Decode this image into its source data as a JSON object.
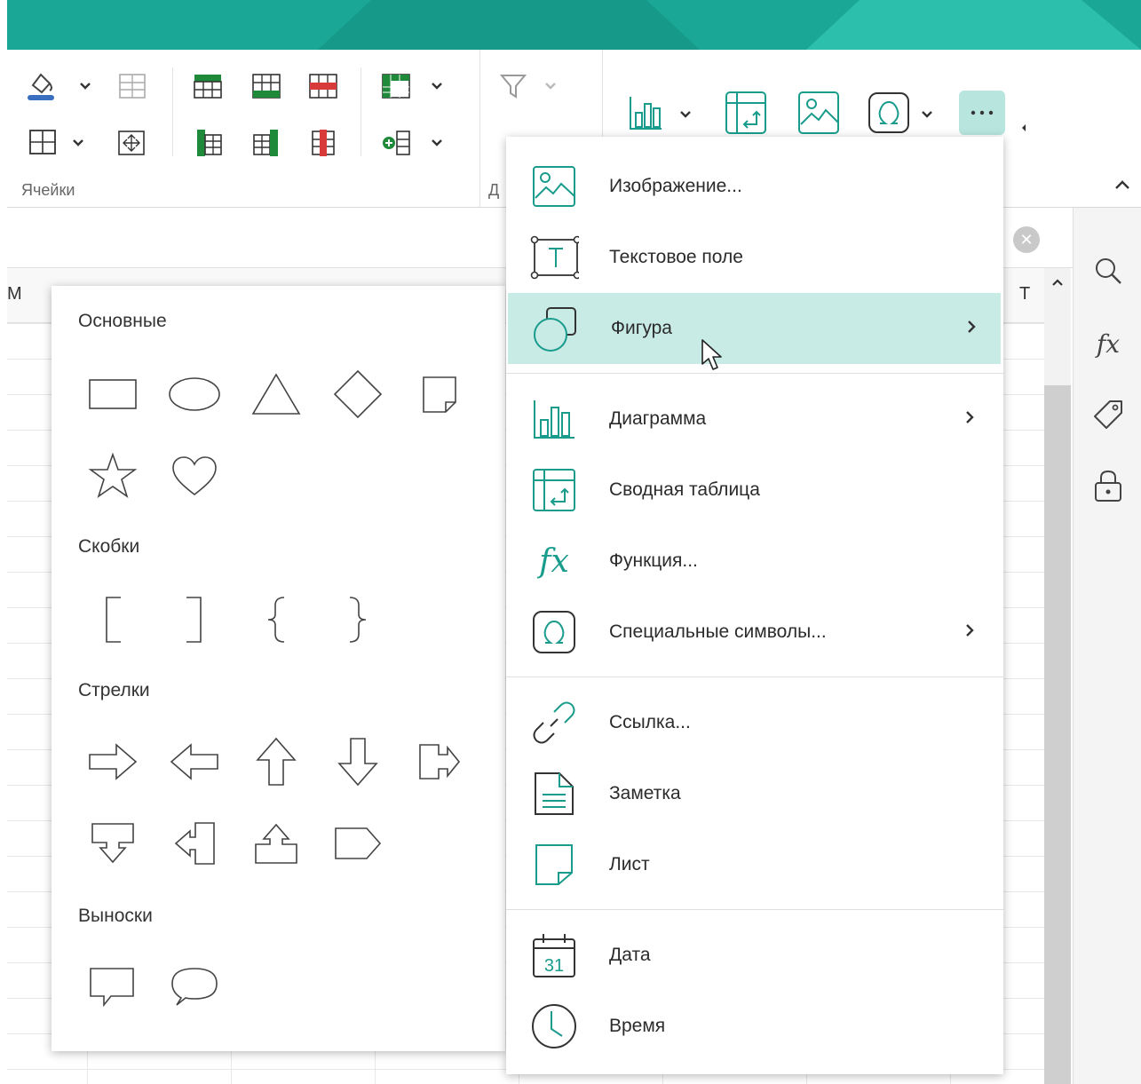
{
  "ribbon": {
    "cells_group_label": "Ячейки",
    "data_group_label_partial": "Д"
  },
  "sheet": {
    "col_left": "M",
    "col_right": "T"
  },
  "shapes_panel": {
    "sections": {
      "basic": "Основные",
      "brackets": "Скобки",
      "arrows": "Стрелки",
      "callouts": "Выноски"
    }
  },
  "insert_menu": {
    "items": [
      {
        "label": "Изображение...",
        "icon": "image-icon"
      },
      {
        "label": "Текстовое поле",
        "icon": "text-box-icon"
      },
      {
        "label": "Фигура",
        "icon": "shape-icon",
        "submenu": true,
        "active": true
      },
      {
        "label": "Диаграмма",
        "icon": "chart-icon",
        "submenu": true
      },
      {
        "label": "Сводная таблица",
        "icon": "pivot-table-icon"
      },
      {
        "label": "Функция...",
        "icon": "function-icon"
      },
      {
        "label": "Специальные символы...",
        "icon": "omega-icon",
        "submenu": true
      },
      {
        "label": "Ссылка...",
        "icon": "link-icon"
      },
      {
        "label": "Заметка",
        "icon": "note-icon"
      },
      {
        "label": "Лист",
        "icon": "sheet-icon"
      },
      {
        "label": "Дата",
        "icon": "calendar-icon",
        "calendar_day": "31"
      },
      {
        "label": "Время",
        "icon": "clock-icon"
      }
    ]
  },
  "colors": {
    "accent": "#1aa795",
    "highlight": "#c9ebe6",
    "icon_teal": "#1a9c8c"
  }
}
